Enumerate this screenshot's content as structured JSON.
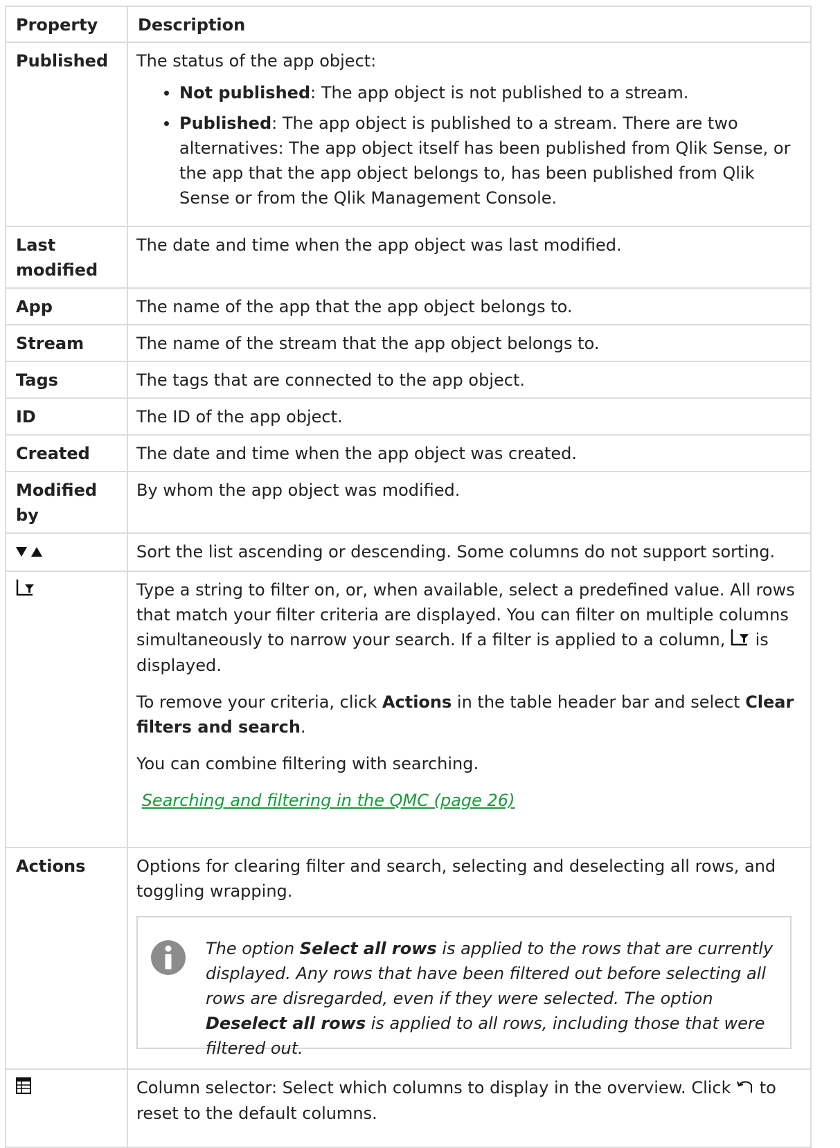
{
  "header": {
    "col1": "Property",
    "col2": "Description"
  },
  "rows": {
    "published": {
      "name": "Published",
      "intro": "The status of the app object:",
      "bullets": [
        {
          "term": "Not published",
          "text": ": The app object is not published to a stream."
        },
        {
          "term": "Published",
          "text": ": The app object is published to a stream. There are two alternatives: The app object itself has been published from Qlik Sense, or the app that the app object belongs to, has been published from Qlik Sense or from the Qlik Management Console."
        }
      ]
    },
    "last_modified": {
      "name": "Last modified",
      "desc": "The date and time when the app object was last modified."
    },
    "app": {
      "name": "App",
      "desc": "The name of the app that the app object belongs to."
    },
    "stream": {
      "name": "Stream",
      "desc": "The name of the stream that the app object belongs to."
    },
    "tags": {
      "name": "Tags",
      "desc": "The tags that are connected to the app object."
    },
    "id": {
      "name": "ID",
      "desc": "The ID of the app object."
    },
    "created": {
      "name": "Created",
      "desc": "The date and time when the app object was created."
    },
    "modified_by": {
      "name": "Modified by",
      "desc": "By whom the app object was modified."
    },
    "sort": {
      "icon": "sort-arrows-icon",
      "desc": "Sort the list ascending or descending. Some columns do not support sorting."
    },
    "filter": {
      "icon": "filter-icon",
      "p1_a": "Type a string to filter on, or, when available, select a predefined value. All rows that match your filter criteria are displayed. You can filter on multiple columns simultaneously to narrow your search. If a filter is applied to a column,",
      "p1_b": "is displayed.",
      "p2_a": "To remove your criteria, click ",
      "p2_actions": "Actions",
      "p2_b": " in the table header bar and select ",
      "p2_clear": "Clear filters and search",
      "p2_c": ".",
      "p3": "You can combine filtering with searching.",
      "link": "Searching and filtering in the QMC (page 26)"
    },
    "actions": {
      "name": "Actions",
      "desc": "Options for clearing filter and search, selecting and deselecting all rows, and toggling wrapping.",
      "note": {
        "icon": "info-icon",
        "a": "The option ",
        "select_all": "Select all rows",
        "b": " is applied to the rows that are currently displayed. Any rows that have been filtered out before selecting all rows are disregarded, even if they were selected. The option ",
        "deselect_all": "Deselect all rows",
        "c": " is applied to all rows, including those that were filtered out."
      }
    },
    "column_selector": {
      "icon": "column-selector-icon",
      "a": "Column selector: Select which columns to display in the overview. Click ",
      "reset_icon": "undo-arrow-icon",
      "b": " to reset to the default columns."
    }
  },
  "colors": {
    "border": "#dcdcdc",
    "link": "#1a9a3a",
    "info_icon": "#8c8c8c",
    "text": "#222222"
  }
}
